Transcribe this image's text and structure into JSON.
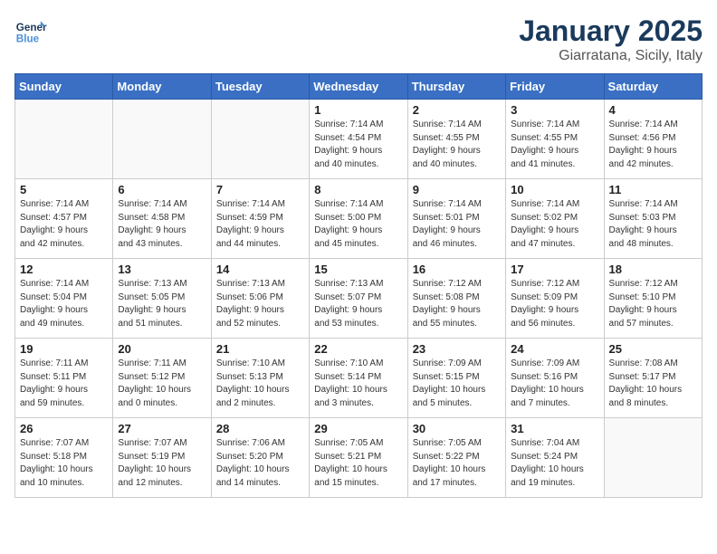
{
  "header": {
    "logo_line1": "General",
    "logo_line2": "Blue",
    "month": "January 2025",
    "location": "Giarratana, Sicily, Italy"
  },
  "weekdays": [
    "Sunday",
    "Monday",
    "Tuesday",
    "Wednesday",
    "Thursday",
    "Friday",
    "Saturday"
  ],
  "weeks": [
    [
      {
        "day": "",
        "info": ""
      },
      {
        "day": "",
        "info": ""
      },
      {
        "day": "",
        "info": ""
      },
      {
        "day": "1",
        "info": "Sunrise: 7:14 AM\nSunset: 4:54 PM\nDaylight: 9 hours\nand 40 minutes."
      },
      {
        "day": "2",
        "info": "Sunrise: 7:14 AM\nSunset: 4:55 PM\nDaylight: 9 hours\nand 40 minutes."
      },
      {
        "day": "3",
        "info": "Sunrise: 7:14 AM\nSunset: 4:55 PM\nDaylight: 9 hours\nand 41 minutes."
      },
      {
        "day": "4",
        "info": "Sunrise: 7:14 AM\nSunset: 4:56 PM\nDaylight: 9 hours\nand 42 minutes."
      }
    ],
    [
      {
        "day": "5",
        "info": "Sunrise: 7:14 AM\nSunset: 4:57 PM\nDaylight: 9 hours\nand 42 minutes."
      },
      {
        "day": "6",
        "info": "Sunrise: 7:14 AM\nSunset: 4:58 PM\nDaylight: 9 hours\nand 43 minutes."
      },
      {
        "day": "7",
        "info": "Sunrise: 7:14 AM\nSunset: 4:59 PM\nDaylight: 9 hours\nand 44 minutes."
      },
      {
        "day": "8",
        "info": "Sunrise: 7:14 AM\nSunset: 5:00 PM\nDaylight: 9 hours\nand 45 minutes."
      },
      {
        "day": "9",
        "info": "Sunrise: 7:14 AM\nSunset: 5:01 PM\nDaylight: 9 hours\nand 46 minutes."
      },
      {
        "day": "10",
        "info": "Sunrise: 7:14 AM\nSunset: 5:02 PM\nDaylight: 9 hours\nand 47 minutes."
      },
      {
        "day": "11",
        "info": "Sunrise: 7:14 AM\nSunset: 5:03 PM\nDaylight: 9 hours\nand 48 minutes."
      }
    ],
    [
      {
        "day": "12",
        "info": "Sunrise: 7:14 AM\nSunset: 5:04 PM\nDaylight: 9 hours\nand 49 minutes."
      },
      {
        "day": "13",
        "info": "Sunrise: 7:13 AM\nSunset: 5:05 PM\nDaylight: 9 hours\nand 51 minutes."
      },
      {
        "day": "14",
        "info": "Sunrise: 7:13 AM\nSunset: 5:06 PM\nDaylight: 9 hours\nand 52 minutes."
      },
      {
        "day": "15",
        "info": "Sunrise: 7:13 AM\nSunset: 5:07 PM\nDaylight: 9 hours\nand 53 minutes."
      },
      {
        "day": "16",
        "info": "Sunrise: 7:12 AM\nSunset: 5:08 PM\nDaylight: 9 hours\nand 55 minutes."
      },
      {
        "day": "17",
        "info": "Sunrise: 7:12 AM\nSunset: 5:09 PM\nDaylight: 9 hours\nand 56 minutes."
      },
      {
        "day": "18",
        "info": "Sunrise: 7:12 AM\nSunset: 5:10 PM\nDaylight: 9 hours\nand 57 minutes."
      }
    ],
    [
      {
        "day": "19",
        "info": "Sunrise: 7:11 AM\nSunset: 5:11 PM\nDaylight: 9 hours\nand 59 minutes."
      },
      {
        "day": "20",
        "info": "Sunrise: 7:11 AM\nSunset: 5:12 PM\nDaylight: 10 hours\nand 0 minutes."
      },
      {
        "day": "21",
        "info": "Sunrise: 7:10 AM\nSunset: 5:13 PM\nDaylight: 10 hours\nand 2 minutes."
      },
      {
        "day": "22",
        "info": "Sunrise: 7:10 AM\nSunset: 5:14 PM\nDaylight: 10 hours\nand 3 minutes."
      },
      {
        "day": "23",
        "info": "Sunrise: 7:09 AM\nSunset: 5:15 PM\nDaylight: 10 hours\nand 5 minutes."
      },
      {
        "day": "24",
        "info": "Sunrise: 7:09 AM\nSunset: 5:16 PM\nDaylight: 10 hours\nand 7 minutes."
      },
      {
        "day": "25",
        "info": "Sunrise: 7:08 AM\nSunset: 5:17 PM\nDaylight: 10 hours\nand 8 minutes."
      }
    ],
    [
      {
        "day": "26",
        "info": "Sunrise: 7:07 AM\nSunset: 5:18 PM\nDaylight: 10 hours\nand 10 minutes."
      },
      {
        "day": "27",
        "info": "Sunrise: 7:07 AM\nSunset: 5:19 PM\nDaylight: 10 hours\nand 12 minutes."
      },
      {
        "day": "28",
        "info": "Sunrise: 7:06 AM\nSunset: 5:20 PM\nDaylight: 10 hours\nand 14 minutes."
      },
      {
        "day": "29",
        "info": "Sunrise: 7:05 AM\nSunset: 5:21 PM\nDaylight: 10 hours\nand 15 minutes."
      },
      {
        "day": "30",
        "info": "Sunrise: 7:05 AM\nSunset: 5:22 PM\nDaylight: 10 hours\nand 17 minutes."
      },
      {
        "day": "31",
        "info": "Sunrise: 7:04 AM\nSunset: 5:24 PM\nDaylight: 10 hours\nand 19 minutes."
      },
      {
        "day": "",
        "info": ""
      }
    ]
  ]
}
